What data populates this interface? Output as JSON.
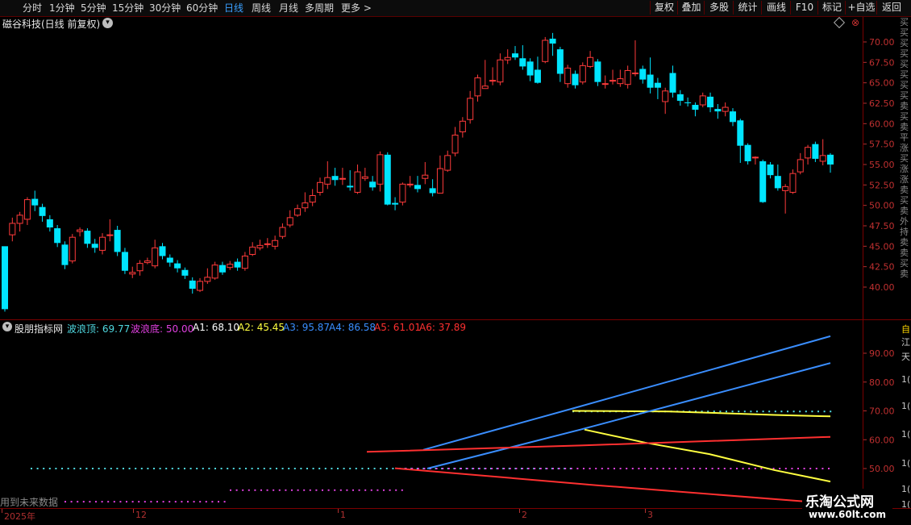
{
  "toolbar": {
    "periods": [
      "分时",
      "1分钟",
      "5分钟",
      "15分钟",
      "30分钟",
      "60分钟",
      "日线",
      "周线",
      "月线",
      "多周期",
      "更多 >"
    ],
    "active_period": "日线",
    "right_buttons": [
      "复权",
      "叠加",
      "多股",
      "统计",
      "画线",
      "F10",
      "标记",
      "+自选",
      "返回"
    ]
  },
  "stock_title": "磁谷科技(日线 前复权)",
  "right_strip_text": "买买买买买买买买卖买卖平涨买涨涨卖买卖外持卖卖买卖",
  "indicator": {
    "name": "股朋指标网",
    "values": [
      {
        "label": "波浪顶:",
        "value": "69.77",
        "color": "#4fd8e0"
      },
      {
        "label": "波浪底:",
        "value": "50.00",
        "color": "#e040e0"
      },
      {
        "label": "A1:",
        "value": "68.10",
        "color": "#ffffff"
      },
      {
        "label": "A2:",
        "value": "45.45",
        "color": "#ffff40"
      },
      {
        "label": "A3:",
        "value": "95.87",
        "color": "#3a8eff"
      },
      {
        "label": "A4:",
        "value": "86.58",
        "color": "#3a8eff"
      },
      {
        "label": "A5:",
        "value": "61.01",
        "color": "#ff3030"
      },
      {
        "label": "A6:",
        "value": "37.89",
        "color": "#ff3030"
      }
    ]
  },
  "foot_note": "用到未来数据",
  "time_axis": [
    "2025年",
    "12",
    "1",
    "2",
    "3"
  ],
  "price_axis": [
    "70.00",
    "67.50",
    "65.00",
    "62.50",
    "60.00",
    "57.50",
    "55.00",
    "52.50",
    "50.00",
    "47.50",
    "45.00",
    "42.50",
    "40.00"
  ],
  "ind_axis": [
    "90.00",
    "80.00",
    "70.00",
    "60.00",
    "50.00"
  ],
  "right_markers": [
    "自",
    "江",
    "天",
    "1(",
    "1(",
    "1(",
    "1(",
    "1(",
    "1("
  ],
  "logo": {
    "main": "乐淘公式网",
    "sub": "www.60lt.com"
  },
  "colors": {
    "up": "#ff3b3b",
    "down": "#00e5ff",
    "axis": "#b03030",
    "cyan_dot": "#4fd8e0",
    "magenta_dot": "#e040e0"
  },
  "candles": [
    [
      45.0,
      37.3,
      44.8,
      37.0
    ],
    [
      46.4,
      47.8,
      48.5,
      45.6
    ],
    [
      47.8,
      48.8,
      49.2,
      46.8
    ],
    [
      48.3,
      50.7,
      51.0,
      47.6
    ],
    [
      50.8,
      50.0,
      51.8,
      49.3
    ],
    [
      49.8,
      48.7,
      50.2,
      48.0
    ],
    [
      48.3,
      47.3,
      48.8,
      46.8
    ],
    [
      47.2,
      45.4,
      47.6,
      44.9
    ],
    [
      45.2,
      42.7,
      45.6,
      42.2
    ],
    [
      43.2,
      46.1,
      46.5,
      42.9
    ],
    [
      46.8,
      47.0,
      47.3,
      46.2
    ],
    [
      46.9,
      45.3,
      47.2,
      44.8
    ],
    [
      45.3,
      44.8,
      45.9,
      44.2
    ],
    [
      44.5,
      46.1,
      46.6,
      44.0
    ],
    [
      46.3,
      46.4,
      48.3,
      45.6
    ],
    [
      47.0,
      44.3,
      47.5,
      43.8
    ],
    [
      44.3,
      42.0,
      44.8,
      41.6
    ],
    [
      41.6,
      41.8,
      42.5,
      41.1
    ],
    [
      42.0,
      42.9,
      43.3,
      41.4
    ],
    [
      43.0,
      43.2,
      43.6,
      42.8
    ],
    [
      42.6,
      44.8,
      45.8,
      42.3
    ],
    [
      45.0,
      43.8,
      45.4,
      43.4
    ],
    [
      43.6,
      43.0,
      44.0,
      42.5
    ],
    [
      42.9,
      42.3,
      43.3,
      41.8
    ],
    [
      42.1,
      41.4,
      42.4,
      41.0
    ],
    [
      40.8,
      39.8,
      41.2,
      39.2
    ],
    [
      39.6,
      40.7,
      41.1,
      39.4
    ],
    [
      40.7,
      41.2,
      42.3,
      40.4
    ],
    [
      41.1,
      42.7,
      43.1,
      40.9
    ],
    [
      42.7,
      41.8,
      43.1,
      41.5
    ],
    [
      42.4,
      42.8,
      43.2,
      42.1
    ],
    [
      43.1,
      42.4,
      43.5,
      42.0
    ],
    [
      42.3,
      43.8,
      44.3,
      42.0
    ],
    [
      44.0,
      44.9,
      45.5,
      43.8
    ],
    [
      44.8,
      45.1,
      45.8,
      44.5
    ],
    [
      45.2,
      45.3,
      46.0,
      44.8
    ],
    [
      45.0,
      45.7,
      46.3,
      44.6
    ],
    [
      46.2,
      47.3,
      47.8,
      45.9
    ],
    [
      47.6,
      48.5,
      49.4,
      47.3
    ],
    [
      48.8,
      49.6,
      50.1,
      48.6
    ],
    [
      49.7,
      50.3,
      51.6,
      49.2
    ],
    [
      50.4,
      51.2,
      52.0,
      49.9
    ],
    [
      51.6,
      52.8,
      53.4,
      51.2
    ],
    [
      52.6,
      53.4,
      55.4,
      52.0
    ],
    [
      53.6,
      53.1,
      54.6,
      52.4
    ],
    [
      53.2,
      53.3,
      54.6,
      52.5
    ],
    [
      52.4,
      52.2,
      54.3,
      51.8
    ],
    [
      51.6,
      54.1,
      55.0,
      51.4
    ],
    [
      53.3,
      53.5,
      54.6,
      53.0
    ],
    [
      52.9,
      52.2,
      53.6,
      51.8
    ],
    [
      52.6,
      56.2,
      56.6,
      51.7
    ],
    [
      56.2,
      50.1,
      56.5,
      50.0
    ],
    [
      50.3,
      50.1,
      51.0,
      49.4
    ],
    [
      50.4,
      52.6,
      52.8,
      50.0
    ],
    [
      52.5,
      52.6,
      53.6,
      52.2
    ],
    [
      52.5,
      52.0,
      53.6,
      51.6
    ],
    [
      53.3,
      53.7,
      55.3,
      52.6
    ],
    [
      52.1,
      51.5,
      53.2,
      51.1
    ],
    [
      51.5,
      54.5,
      56.1,
      51.5
    ],
    [
      54.3,
      56.1,
      56.7,
      54.1
    ],
    [
      56.4,
      58.6,
      59.6,
      56.0
    ],
    [
      59.0,
      60.3,
      60.8,
      58.3
    ],
    [
      60.5,
      63.1,
      64.0,
      60.0
    ],
    [
      63.4,
      65.6,
      66.0,
      62.7
    ],
    [
      64.3,
      64.6,
      67.8,
      64.3
    ],
    [
      65.3,
      65.3,
      66.9,
      64.7
    ],
    [
      65.1,
      67.8,
      68.6,
      64.7
    ],
    [
      67.8,
      68.1,
      69.1,
      67.3
    ],
    [
      68.6,
      68.1,
      69.5,
      67.8
    ],
    [
      68.0,
      67.0,
      69.6,
      66.6
    ],
    [
      67.6,
      65.9,
      68.0,
      65.2
    ],
    [
      66.6,
      65.0,
      68.2,
      64.9
    ],
    [
      67.6,
      70.2,
      70.6,
      67.4
    ],
    [
      70.4,
      69.8,
      71.1,
      68.3
    ],
    [
      69.1,
      66.1,
      69.4,
      65.1
    ],
    [
      64.9,
      66.8,
      67.2,
      64.4
    ],
    [
      66.1,
      64.7,
      66.5,
      64.3
    ],
    [
      65.1,
      67.1,
      67.5,
      64.8
    ],
    [
      67.0,
      68.1,
      68.9,
      66.8
    ],
    [
      67.6,
      65.1,
      67.9,
      64.6
    ],
    [
      64.9,
      64.9,
      65.9,
      64.3
    ],
    [
      65.2,
      65.3,
      66.6,
      64.8
    ],
    [
      64.9,
      65.5,
      66.6,
      64.5
    ],
    [
      64.8,
      66.5,
      67.1,
      64.3
    ],
    [
      66.1,
      66.2,
      70.2,
      65.8
    ],
    [
      66.7,
      65.4,
      67.1,
      64.9
    ],
    [
      66.0,
      64.4,
      68.1,
      63.7
    ],
    [
      65.0,
      64.4,
      65.6,
      63.0
    ],
    [
      62.7,
      64.0,
      64.4,
      61.2
    ],
    [
      66.2,
      63.8,
      67.1,
      63.2
    ],
    [
      63.6,
      62.8,
      64.1,
      62.2
    ],
    [
      62.6,
      62.5,
      63.2,
      62.1
    ],
    [
      62.3,
      61.7,
      62.6,
      60.9
    ],
    [
      62.3,
      63.4,
      63.8,
      62.0
    ],
    [
      63.3,
      62.0,
      63.8,
      61.4
    ],
    [
      61.8,
      61.5,
      62.4,
      60.6
    ],
    [
      61.5,
      62.0,
      62.6,
      60.9
    ],
    [
      61.5,
      60.2,
      61.9,
      59.7
    ],
    [
      60.4,
      57.3,
      60.6,
      55.2
    ],
    [
      57.4,
      55.4,
      57.6,
      55.0
    ],
    [
      55.9,
      55.9,
      56.0,
      55.0
    ],
    [
      55.4,
      50.4,
      55.6,
      50.3
    ],
    [
      55.0,
      53.7,
      55.3,
      53.3
    ],
    [
      53.6,
      52.1,
      55.0,
      51.8
    ],
    [
      51.8,
      52.3,
      52.6,
      49.0
    ],
    [
      51.6,
      53.9,
      54.4,
      51.4
    ],
    [
      54.1,
      55.6,
      56.4,
      53.8
    ],
    [
      55.8,
      57.1,
      57.4,
      55.0
    ],
    [
      57.5,
      55.7,
      57.8,
      55.3
    ],
    [
      55.4,
      56.1,
      58.1,
      54.9
    ],
    [
      56.2,
      55.0,
      56.4,
      54.0
    ]
  ],
  "ind_lines": {
    "yellow_top": {
      "color": "#ffff40",
      "pts": [
        [
          710,
          70.0
        ],
        [
          830,
          69.8
        ],
        [
          960,
          68.6
        ],
        [
          1030,
          68.1
        ]
      ]
    },
    "yellow_mid": {
      "color": "#ffff40",
      "pts": [
        [
          725,
          63.5
        ],
        [
          800,
          59.0
        ],
        [
          880,
          55.0
        ],
        [
          960,
          49.5
        ],
        [
          1030,
          45.5
        ]
      ]
    },
    "blue_a3": {
      "color": "#3a8eff",
      "pts": [
        [
          525,
          56.5
        ],
        [
          710,
          70.8
        ],
        [
          1030,
          95.9
        ]
      ]
    },
    "blue_a4": {
      "color": "#3a8eff",
      "pts": [
        [
          530,
          50.0
        ],
        [
          720,
          63.5
        ],
        [
          1030,
          86.6
        ]
      ]
    },
    "red_a5": {
      "color": "#ff3030",
      "pts": [
        [
          455,
          55.8
        ],
        [
          720,
          58.0
        ],
        [
          1030,
          61.0
        ]
      ]
    },
    "red_a6": {
      "color": "#ff3030",
      "pts": [
        [
          490,
          50.1
        ],
        [
          740,
          44.2
        ],
        [
          1030,
          37.9
        ]
      ]
    },
    "cyan_dots": {
      "from": 38,
      "to": 710,
      "value": 50.0,
      "from2": 710,
      "to2": 1030,
      "value2": 69.8
    },
    "magenta_dots": {
      "from": 495,
      "to": 1030,
      "value": 50.0,
      "lowfrom": 285,
      "lowto": 500,
      "lowvalue": 42.5,
      "low2from": 80,
      "low2to": 285,
      "low2value": 38.5
    }
  }
}
